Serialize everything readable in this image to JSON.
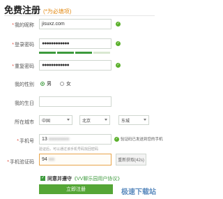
{
  "header": {
    "title": "免费注册",
    "required_note": "(*为必填项)"
  },
  "form": {
    "nickname": {
      "label": "我的昵称",
      "value": "jisuxz.com"
    },
    "password": {
      "label": "登录密码",
      "value": "●●●●●●●●●●●●"
    },
    "password_strength": {
      "level": 3,
      "max": 4
    },
    "confirm_password": {
      "label": "重复密码",
      "value": "●●●●●●●●●●●●"
    },
    "gender": {
      "label": "我的性别",
      "options": [
        "男",
        "女"
      ],
      "selected": "男"
    },
    "birthday": {
      "label": "我的生日",
      "value": ""
    },
    "city": {
      "label": "所在城市",
      "country": "中国",
      "province": "北京",
      "district": "东城"
    },
    "phone": {
      "label": "手机号",
      "value": "13",
      "hint": "验证码已发送到您的手机",
      "hint_below": "验证后，可以通过该手机号码找回密码"
    },
    "sms_code": {
      "label": "手机验证码",
      "value": "94",
      "resend_label": "重新获取(42s)"
    }
  },
  "agreement": {
    "prefix": "同意并遵守",
    "link": "《VV聊乐园用户协议》",
    "checked": true
  },
  "submit_label": "立即注册",
  "watermark": "极速下载站",
  "colors": {
    "accent": "#3c9a3c",
    "required": "#e04a3c",
    "note": "#e38b16"
  }
}
